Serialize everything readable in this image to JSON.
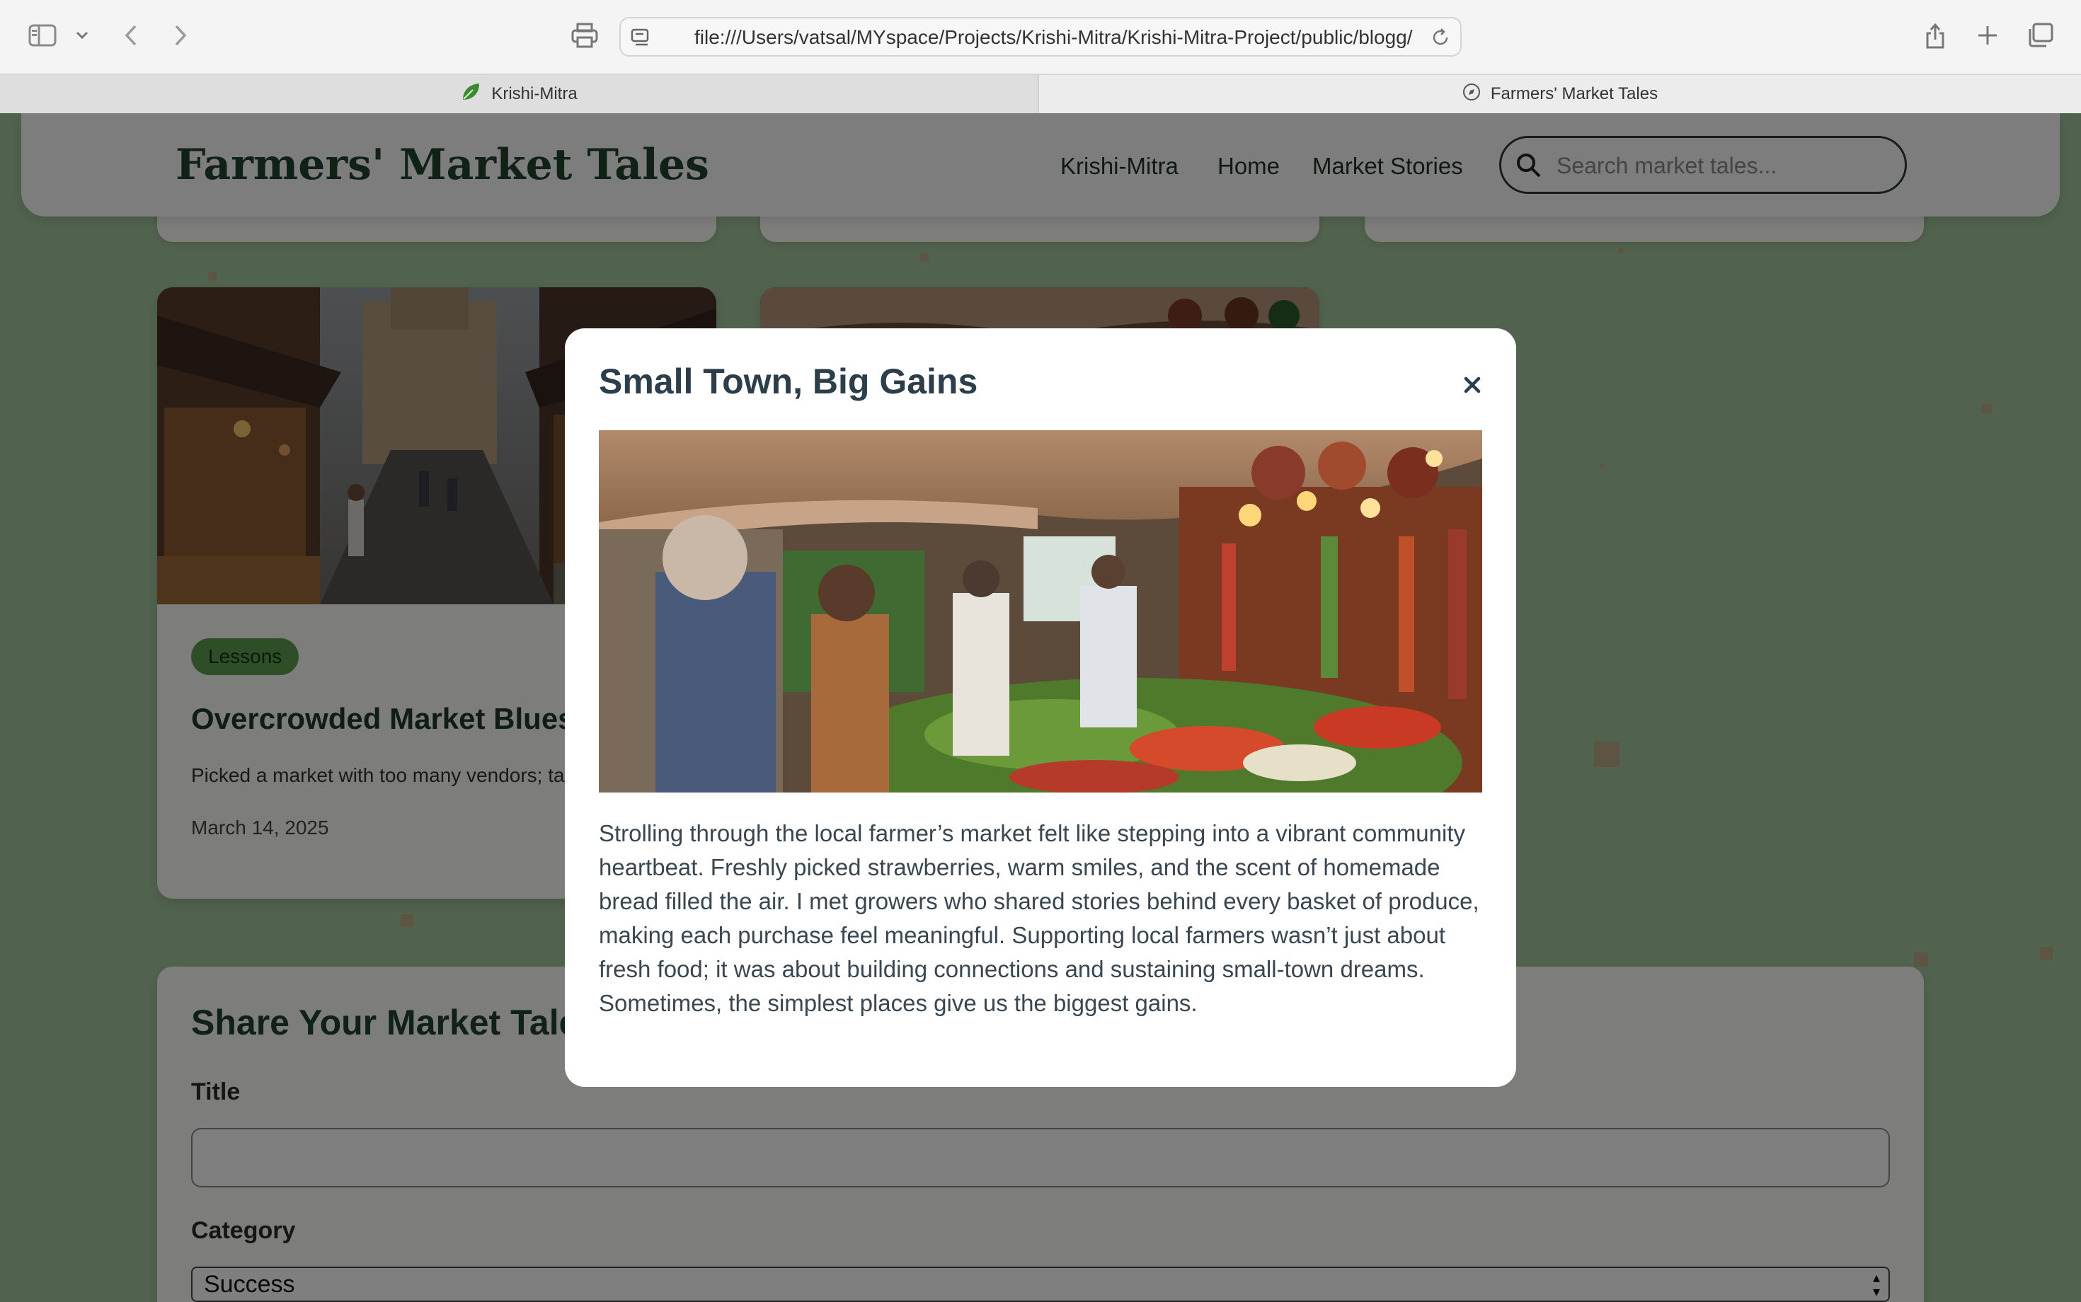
{
  "browser": {
    "url": "file:///Users/vatsal/MYspace/Projects/Krishi-Mitra/Krishi-Mitra-Project/public/blogg/index.html",
    "tabs": [
      {
        "label": "Krishi-Mitra",
        "active": false
      },
      {
        "label": "Farmers' Market Tales",
        "active": true
      }
    ]
  },
  "header": {
    "logo": "Farmers' Market Tales",
    "nav": [
      "Krishi-Mitra",
      "Home",
      "Market Stories"
    ],
    "search_placeholder": "Search market tales..."
  },
  "cards": [
    {
      "category": "Lessons",
      "title": "Overcrowded Market Blues",
      "excerpt": "Picked a market with too many vendors; tanked.",
      "date": "March 14, 2025"
    }
  ],
  "form": {
    "title": "Share Your Market Tale",
    "title_label": "Title",
    "category_label": "Category",
    "category_selected": "Success"
  },
  "modal": {
    "title": "Small Town, Big Gains",
    "close_icon": "×",
    "body": "Strolling through the local farmer’s market felt like stepping into a vibrant community heartbeat. Freshly picked strawberries, warm smiles, and the scent of homemade bread filled the air. I met growers who shared stories behind every basket of produce, making each purchase feel meaningful. Supporting local farmers wasn’t just about fresh food; it was about building connections and sustaining small-town dreams. Sometimes, the simplest places give us the biggest gains."
  },
  "colors": {
    "page_bg": "#a3c79c",
    "brand_green": "#21432d",
    "badge_green": "#5b9c4f",
    "overlay": "rgba(0,0,0,0.5)"
  }
}
